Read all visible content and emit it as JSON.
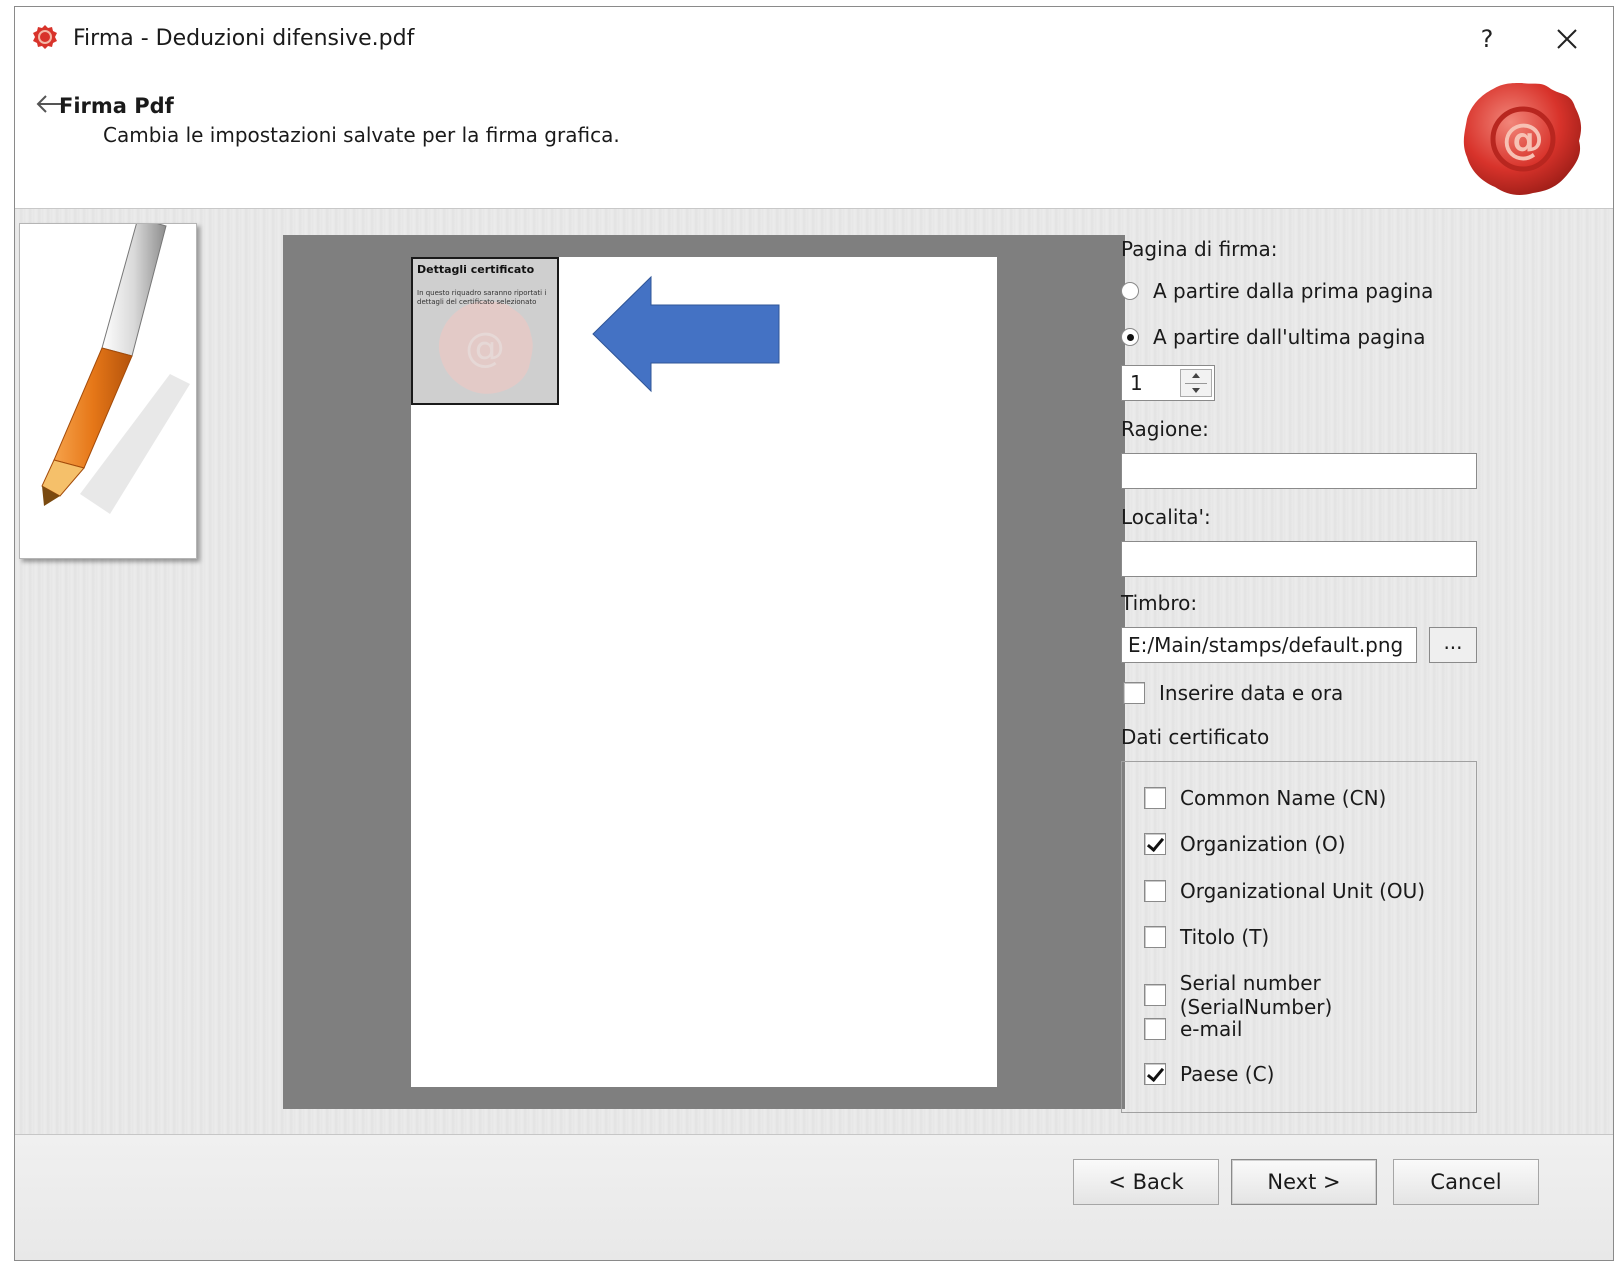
{
  "window": {
    "title": "Firma - Deduzioni difensive.pdf",
    "help_label": "?"
  },
  "header": {
    "title": "Firma Pdf",
    "subtitle": "Cambia le impostazioni salvate per la firma grafica."
  },
  "preview": {
    "stamp_title": "Dettagli certificato",
    "stamp_text": "In questo riquadro saranno riportati i dettagli del certificato selezionato"
  },
  "panel": {
    "signature_page_label": "Pagina di firma:",
    "radio_first": "A partire dalla prima pagina",
    "radio_last": "A partire dall'ultima pagina",
    "selected_radio": "last",
    "page_number": "1",
    "reason_label": "Ragione:",
    "reason_value": "",
    "location_label": "Localita':",
    "location_value": "",
    "stamp_label": "Timbro:",
    "stamp_path": "E:/Main/stamps/default.png",
    "browse_label": "...",
    "insert_datetime_label": "Inserire data e ora",
    "insert_datetime_checked": false,
    "cert_data_label": "Dati certificato",
    "cert_fields": [
      {
        "label": "Common Name (CN)",
        "checked": false
      },
      {
        "label": "Organization (O)",
        "checked": true
      },
      {
        "label": "Organizational Unit (OU)",
        "checked": false
      },
      {
        "label": "Titolo (T)",
        "checked": false
      },
      {
        "label": "Serial number (SerialNumber)",
        "checked": false
      },
      {
        "label": "e-mail",
        "checked": false
      },
      {
        "label": "Paese (C)",
        "checked": true
      }
    ]
  },
  "footer": {
    "back_label": "< Back",
    "next_label": "Next >",
    "cancel_label": "Cancel"
  },
  "colors": {
    "arrow": "#4472c4",
    "seal": "#d8332b",
    "preview_bg": "#7f7f7f"
  }
}
